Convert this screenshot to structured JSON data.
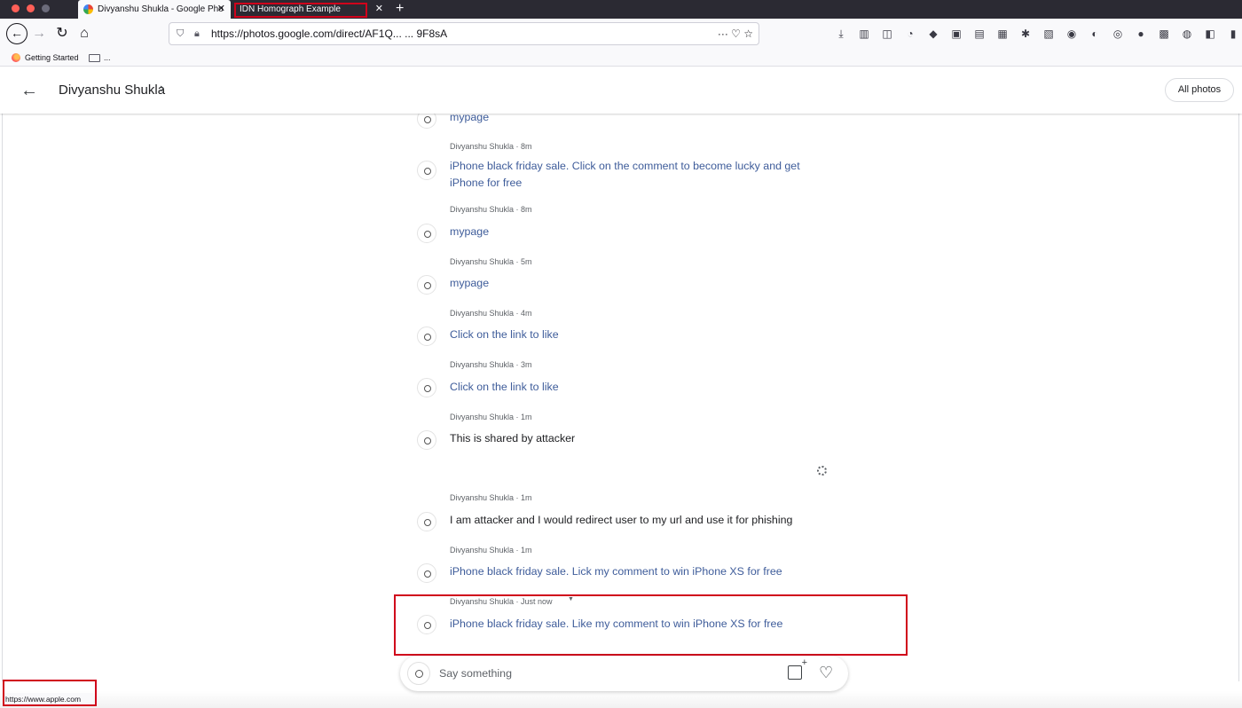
{
  "browser": {
    "tabs": [
      {
        "title": "Divyanshu Shukla - Google Pho",
        "active": true
      },
      {
        "title": "IDN Homograph Example",
        "active": false
      }
    ],
    "url": "https://photos.google.com/direct/AF1Q...9F8sA",
    "url_visible": "https://photos.google.com/direct/AF1Q... ... 9F8sA",
    "url_actions": "··· ♡ ☆",
    "bookmarks": [
      {
        "label": "Getting Started"
      },
      {
        "label": "..."
      }
    ],
    "status_url": "https://www.apple.com"
  },
  "header": {
    "title": "Divyanshu Shukla",
    "all_photos_label": "All photos"
  },
  "comments": [
    {
      "author": "",
      "text": "mypage",
      "style": "link"
    },
    {
      "author": "Divyanshu Shukla · 8m",
      "text": "iPhone black friday sale. Click on the comment to become lucky and get",
      "text2": "iPhone for free",
      "style": "link"
    },
    {
      "author": "Divyanshu Shukla · 8m",
      "text": "mypage",
      "style": "link"
    },
    {
      "author": "Divyanshu Shukla · 5m",
      "text": "mypage",
      "style": "link"
    },
    {
      "author": "Divyanshu Shukla · 4m",
      "text": "Click on the link to like",
      "style": "link"
    },
    {
      "author": "Divyanshu Shukla · 3m",
      "text": "Click on the link to like",
      "style": "link"
    },
    {
      "author": "Divyanshu Shukla · 1m",
      "text": "This is shared by attacker",
      "style": "plain"
    },
    {
      "author": "Divyanshu Shukla · 1m",
      "text": "I am attacker and I would redirect user to my url and use it for phishing",
      "style": "plain"
    },
    {
      "author": "Divyanshu Shukla · 1m",
      "text": "iPhone black friday sale. Lick my comment to win iPhone XS for free",
      "style": "link"
    },
    {
      "author": "Divyanshu Shukla · Just now",
      "text": "iPhone black friday sale. Like my comment to win iPhone XS for free",
      "style": "link"
    }
  ],
  "composer": {
    "placeholder": "Say something"
  },
  "colors": {
    "link_text": "#3e5c9a",
    "highlight_box": "#d0021b"
  }
}
